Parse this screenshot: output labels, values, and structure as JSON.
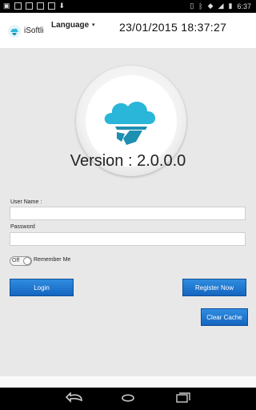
{
  "status_bar": {
    "time": "6:37"
  },
  "app_bar": {
    "logo_text": "iSoftli",
    "language_label": "Language",
    "datetime": "23/01/2015 18:37:27"
  },
  "main": {
    "version_text": "Version : 2.0.0.0",
    "username_label": "User Name :",
    "username_value": "",
    "password_label": "Password",
    "password_value": "",
    "remember_toggle_state": "Off",
    "remember_label": "Remember Me",
    "login_label": "Login",
    "register_label": "Register Now",
    "clear_cache_label": "Clear Cache"
  },
  "colors": {
    "accent": "#1976d2",
    "logo_teal": "#29b6d8"
  }
}
